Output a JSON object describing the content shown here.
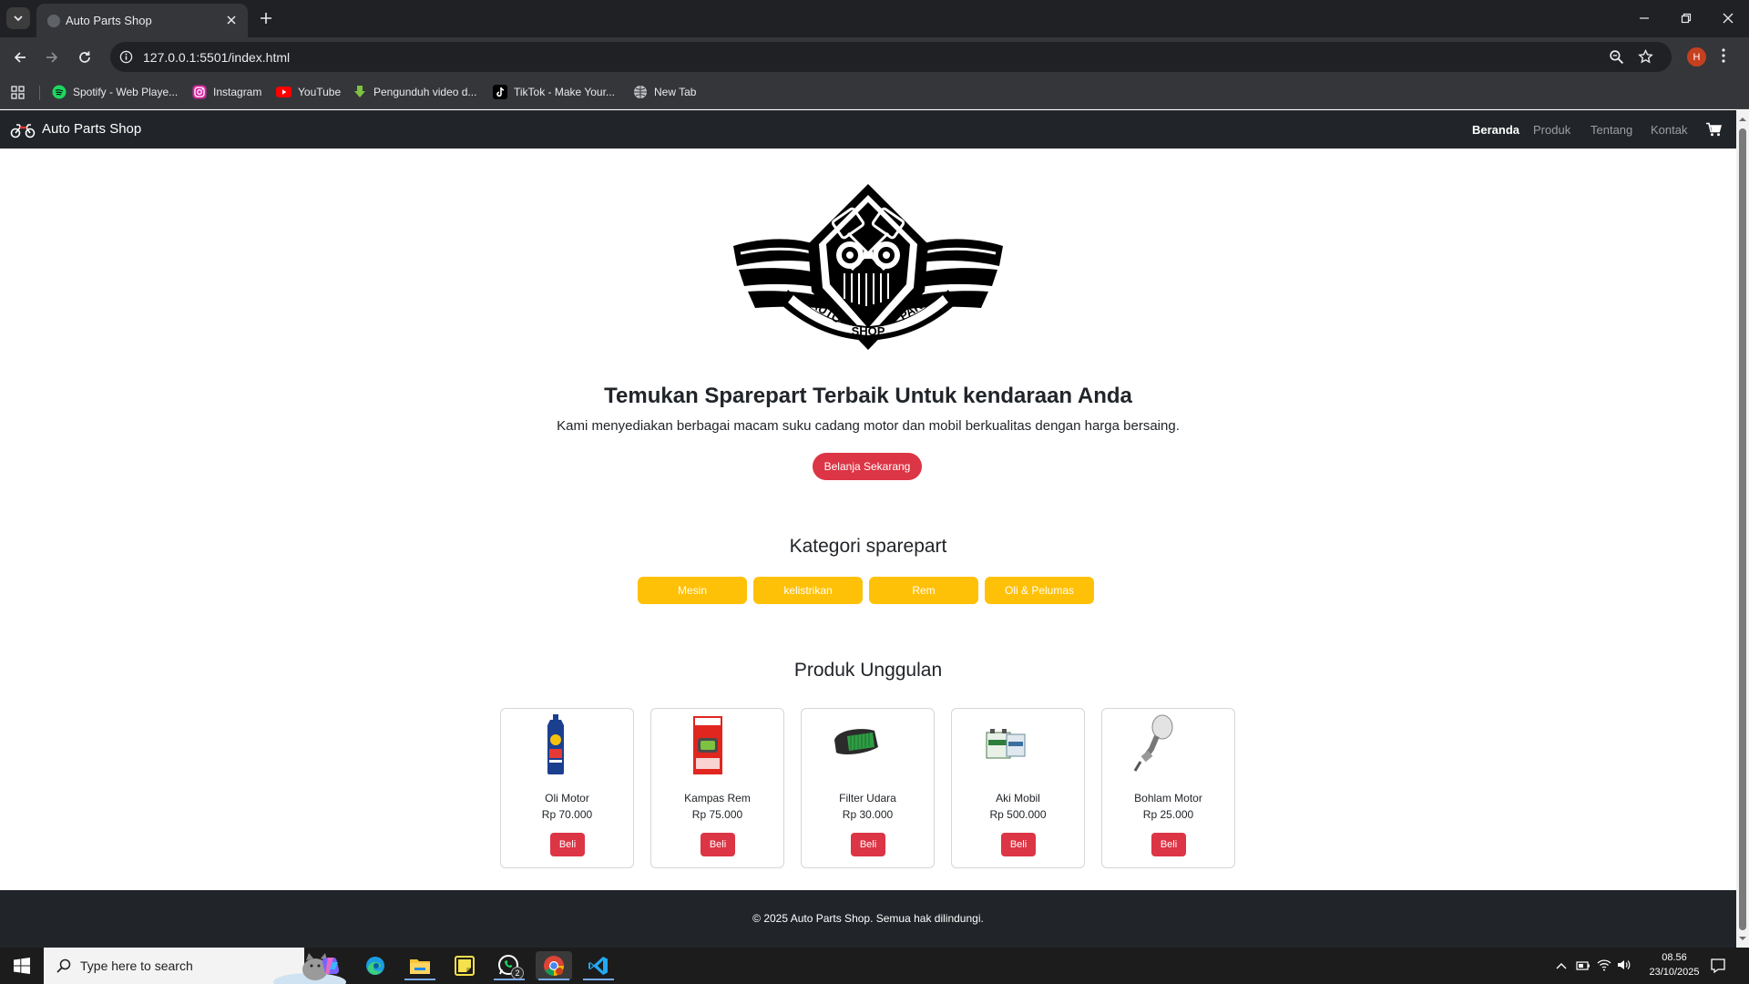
{
  "browser": {
    "tab_title": "Auto Parts Shop",
    "url": "127.0.0.1:5501/index.html",
    "profile_initial": "H",
    "bookmarks": [
      {
        "label": "Spotify - Web Playe...",
        "icon": "spotify-icon"
      },
      {
        "label": "Instagram",
        "icon": "instagram-icon"
      },
      {
        "label": "YouTube",
        "icon": "youtube-icon"
      },
      {
        "label": "Pengunduh video d...",
        "icon": "download-icon"
      },
      {
        "label": "TikTok - Make Your...",
        "icon": "tiktok-icon"
      },
      {
        "label": "New Tab",
        "icon": "globe-icon"
      }
    ]
  },
  "site": {
    "brand": "Auto Parts Shop",
    "nav": [
      {
        "label": "Beranda",
        "active": true
      },
      {
        "label": "Produk",
        "active": false
      },
      {
        "label": "Tentang",
        "active": false
      },
      {
        "label": "Kontak",
        "active": false
      }
    ],
    "logo_text": {
      "left": "AUTO",
      "right": "PARTS",
      "bottom": "SHOP"
    },
    "hero": {
      "title": "Temukan Sparepart Terbaik Untuk kendaraan Anda",
      "subtitle": "Kami menyediakan berbagai macam suku cadang motor dan mobil berkualitas dengan harga bersaing.",
      "button": "Belanja Sekarang"
    },
    "categories": {
      "title": "Kategori sparepart",
      "items": [
        "Mesin",
        "kelistrikan",
        "Rem",
        "Oli & Pelumas"
      ]
    },
    "products": {
      "title": "Produk Unggulan",
      "buy_label": "Beli",
      "items": [
        {
          "name": "Oli Motor",
          "price": "Rp 70.000"
        },
        {
          "name": "Kampas Rem",
          "price": "Rp 75.000"
        },
        {
          "name": "Filter Udara",
          "price": "Rp 30.000"
        },
        {
          "name": "Aki Mobil",
          "price": "Rp 500.000"
        },
        {
          "name": "Bohlam Motor",
          "price": "Rp 25.000"
        }
      ]
    },
    "footer": "© 2025 Auto Parts Shop. Semua hak dilindungi."
  },
  "taskbar": {
    "search_placeholder": "Type here to search",
    "whatsapp_badge": "2",
    "time": "08.56",
    "date": "23/10/2025"
  },
  "colors": {
    "primary_red": "#dc3545",
    "category_yellow": "#ffc107",
    "navbar_dark": "#212529"
  }
}
